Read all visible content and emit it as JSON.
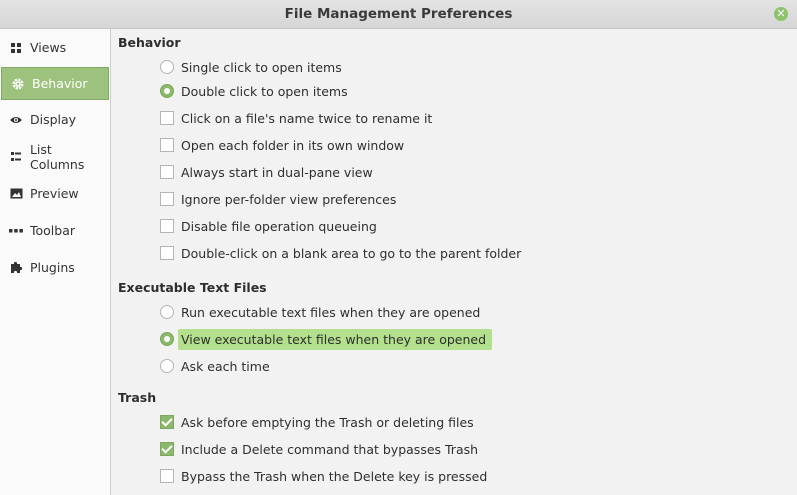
{
  "window": {
    "title": "File Management Preferences"
  },
  "colors": {
    "accent": "#9cc27e",
    "highlight": "#b3e08c"
  },
  "sidebar": {
    "items": [
      {
        "label": "Views",
        "icon": "grid-icon",
        "active": false
      },
      {
        "label": "Behavior",
        "icon": "gear-icon",
        "active": true
      },
      {
        "label": "Display",
        "icon": "eye-icon",
        "active": false
      },
      {
        "label": "List Columns",
        "icon": "list-icon",
        "active": false
      },
      {
        "label": "Preview",
        "icon": "image-icon",
        "active": false
      },
      {
        "label": "Toolbar",
        "icon": "dots-icon",
        "active": false
      },
      {
        "label": "Plugins",
        "icon": "puzzle-icon",
        "active": false
      }
    ]
  },
  "behavior": {
    "heading": "Behavior",
    "options": [
      {
        "label": "Single click to open items",
        "type": "radio",
        "checked": false
      },
      {
        "label": "Double click to open items",
        "type": "radio",
        "checked": true
      },
      {
        "label": "Click on a file's name twice to rename it",
        "type": "checkbox",
        "checked": false
      },
      {
        "label": "Open each folder in its own window",
        "type": "checkbox",
        "checked": false
      },
      {
        "label": "Always start in dual-pane view",
        "type": "checkbox",
        "checked": false
      },
      {
        "label": "Ignore per-folder view preferences",
        "type": "checkbox",
        "checked": false
      },
      {
        "label": "Disable file operation queueing",
        "type": "checkbox",
        "checked": false
      },
      {
        "label": "Double-click on a blank area to go to the parent folder",
        "type": "checkbox",
        "checked": false
      }
    ]
  },
  "executable": {
    "heading": "Executable Text Files",
    "options": [
      {
        "label": "Run executable text files when they are opened",
        "type": "radio",
        "checked": false
      },
      {
        "label": "View executable text files when they are opened",
        "type": "radio",
        "checked": true
      },
      {
        "label": "Ask each time",
        "type": "radio",
        "checked": false
      }
    ]
  },
  "trash": {
    "heading": "Trash",
    "options": [
      {
        "label": "Ask before emptying the Trash or deleting files",
        "type": "checkbox",
        "checked": true
      },
      {
        "label": "Include a Delete command that bypasses Trash",
        "type": "checkbox",
        "checked": true
      },
      {
        "label": "Bypass the Trash when the Delete key is pressed",
        "type": "checkbox",
        "checked": false
      }
    ]
  }
}
